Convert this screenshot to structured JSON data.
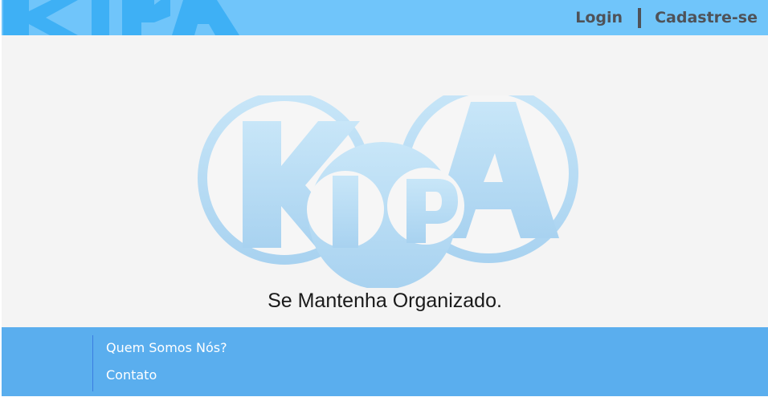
{
  "header": {
    "logo_alt": "KIPA",
    "nav": {
      "login_label": "Login",
      "signup_label": "Cadastre-se"
    }
  },
  "main": {
    "logo_alt": "KIPA",
    "tagline": "Se Mantenha Organizado."
  },
  "footer": {
    "links": [
      {
        "label": "Quem Somos Nós?"
      },
      {
        "label": "Contato"
      }
    ]
  },
  "colors": {
    "header_bg": "#70c5fa",
    "main_bg": "#f4f4f4",
    "footer_bg": "#5aaeee",
    "logo_light_blue": "#b8dcf4",
    "logo_header_blue": "#3eb0f5"
  }
}
